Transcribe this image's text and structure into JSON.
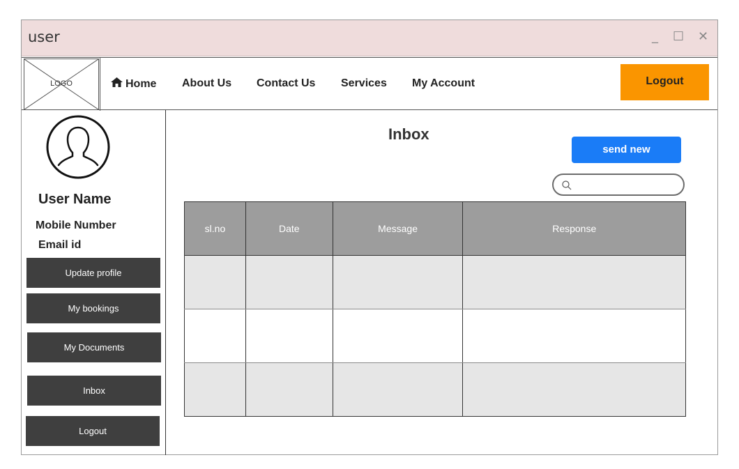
{
  "window": {
    "title": "user",
    "minimize": "_",
    "maximize": "☐",
    "close": "✕"
  },
  "nav": {
    "logo": "LOGO",
    "items": [
      {
        "label": "Home",
        "icon": "home-icon"
      },
      {
        "label": "About Us"
      },
      {
        "label": "Contact Us"
      },
      {
        "label": "Services"
      },
      {
        "label": "My Account"
      }
    ],
    "logout": "Logout"
  },
  "profile": {
    "name": "User Name",
    "mobile": "Mobile Number",
    "email": "Email id"
  },
  "sidebar": {
    "buttons": [
      "Update profile",
      "My bookings",
      "My Documents",
      "Inbox",
      "Logout"
    ]
  },
  "main": {
    "title": "Inbox",
    "send_new": "send new",
    "search": {
      "placeholder": "",
      "value": ""
    },
    "table": {
      "headers": [
        "sl.no",
        "Date",
        "Message",
        "Response"
      ],
      "rows": [
        [
          "",
          "",
          "",
          ""
        ],
        [
          "",
          "",
          "",
          ""
        ],
        [
          "",
          "",
          "",
          ""
        ]
      ]
    }
  },
  "colors": {
    "titlebar": "#efdcdc",
    "logout_button": "#fa9500",
    "send_button": "#1a7cf7",
    "sidebar_button": "#3f3f3f",
    "table_header": "#9d9d9d"
  }
}
